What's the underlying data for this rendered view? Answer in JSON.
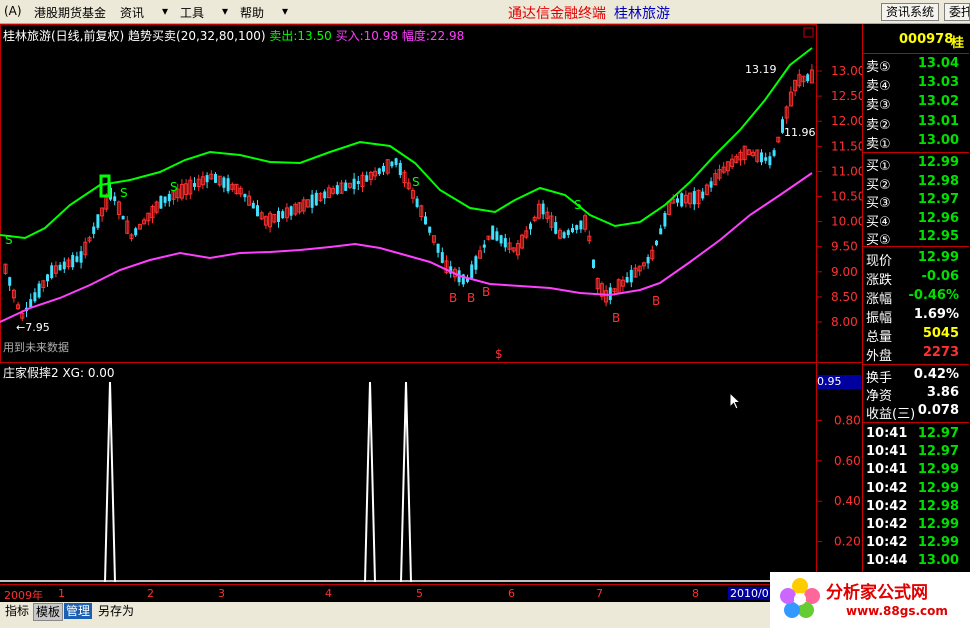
{
  "menubar": {
    "items": [
      "(A)",
      "港股期货基金",
      "资讯",
      "工具",
      "帮助"
    ],
    "brand": "通达信金融终端",
    "stock": "桂林旅游",
    "sys_btn": "资讯系统",
    "sys_btn2": "委托"
  },
  "main_chart": {
    "header_name": "桂林旅游(日线,前复权)",
    "header_indicator": "趋势买卖(20,32,80,100)",
    "sell_label": "卖出:",
    "sell_value": "13.50",
    "buy_label": "买入:",
    "buy_value": "10.98",
    "range_label": "幅度:",
    "range_value": "22.98",
    "annot_high": "13.19",
    "annot_mid": "11.96",
    "annot_low": "7.95",
    "future_warning": "用到未来数据",
    "dollar": "$",
    "price_ticks": [
      "13.00",
      "12.50",
      "12.00",
      "11.50",
      "11.00",
      "10.50",
      "10.00",
      "9.50",
      "9.00",
      "8.50",
      "8.00"
    ]
  },
  "sub_chart": {
    "header": "庄家假摔2 XG: 0.00",
    "current": "0.95",
    "ticks": [
      "0.80",
      "0.60",
      "0.40",
      "0.20"
    ]
  },
  "time_axis": {
    "year_start": "2009年",
    "months": [
      "1",
      "2",
      "3",
      "4",
      "5",
      "6",
      "7",
      "8"
    ],
    "year_end": "2010/0"
  },
  "quote_panel": {
    "code": "000978",
    "name": "桂",
    "asks": [
      {
        "label": "卖⑤",
        "price": "13.04"
      },
      {
        "label": "卖④",
        "price": "13.03"
      },
      {
        "label": "卖③",
        "price": "13.02"
      },
      {
        "label": "卖②",
        "price": "13.01"
      },
      {
        "label": "卖①",
        "price": "13.00"
      }
    ],
    "bids": [
      {
        "label": "买①",
        "price": "12.99"
      },
      {
        "label": "买②",
        "price": "12.98"
      },
      {
        "label": "买③",
        "price": "12.97"
      },
      {
        "label": "买④",
        "price": "12.96"
      },
      {
        "label": "买⑤",
        "price": "12.95"
      }
    ],
    "stats": [
      {
        "label": "现价",
        "value": "12.99",
        "color": "#00e000"
      },
      {
        "label": "涨跌",
        "value": "-0.06",
        "color": "#00e000"
      },
      {
        "label": "涨幅",
        "value": "-0.46%",
        "color": "#00e000"
      },
      {
        "label": "振幅",
        "value": "1.69%",
        "color": "#ffffff"
      },
      {
        "label": "总量",
        "value": "5045",
        "color": "#ffff00"
      },
      {
        "label": "外盘",
        "value": "2273",
        "color": "#ff3030"
      }
    ],
    "stats2": [
      {
        "label": "换手",
        "value": "0.42%"
      },
      {
        "label": "净资",
        "value": "3.86"
      },
      {
        "label": "收益(三)",
        "value": "0.078"
      }
    ],
    "ticks": [
      {
        "time": "10:41",
        "price": "12.97"
      },
      {
        "time": "10:41",
        "price": "12.97"
      },
      {
        "time": "10:41",
        "price": "12.99"
      },
      {
        "time": "10:42",
        "price": "12.99"
      },
      {
        "time": "10:42",
        "price": "12.98"
      },
      {
        "time": "10:42",
        "price": "12.99"
      },
      {
        "time": "10:42",
        "price": "12.99"
      },
      {
        "time": "10:44",
        "price": "13.00"
      }
    ]
  },
  "bottom_tabs": [
    "指标",
    "模板",
    "管理",
    "另存为"
  ],
  "logo": {
    "text": "分析家公式网",
    "url": "www.88gs.com"
  },
  "colors": {
    "up": "#ff3030",
    "down": "#40e0ff",
    "green_line": "#00ff00",
    "magenta_line": "#ff40ff",
    "panel_border": "#c00000"
  }
}
